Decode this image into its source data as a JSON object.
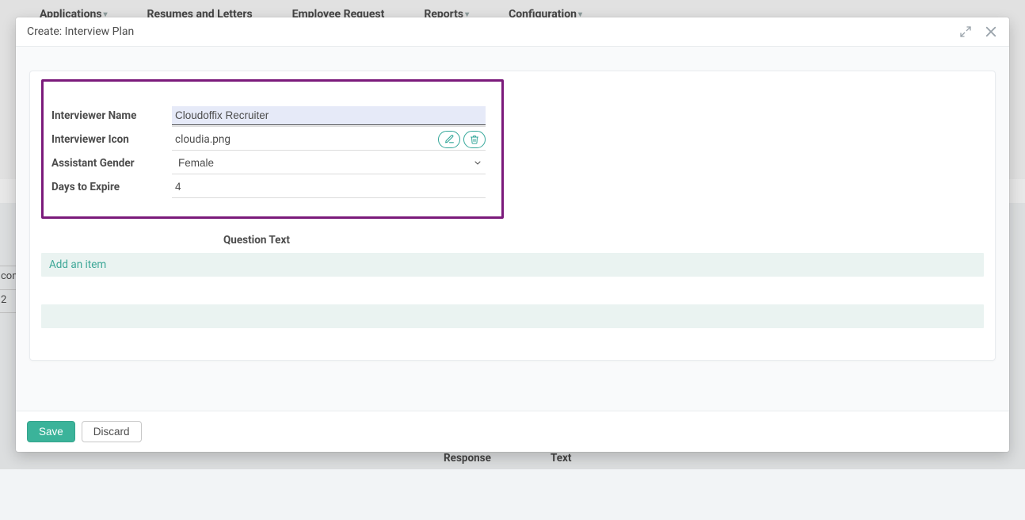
{
  "bg": {
    "menu": [
      "Applications",
      "Resumes and Letters",
      "Employee Request",
      "Reports",
      "Configuration"
    ],
    "left_col_top": "com",
    "left_col_bottom": "2",
    "bottom_labels": [
      "Response",
      "Text"
    ]
  },
  "modal": {
    "title": "Create: Interview Plan",
    "fields": {
      "interviewer_name_label": "Interviewer Name",
      "interviewer_name_value": "Cloudoffix Recruiter",
      "interviewer_icon_label": "Interviewer Icon",
      "interviewer_icon_value": "cloudia.png",
      "assistant_gender_label": "Assistant Gender",
      "assistant_gender_value": "Female",
      "days_to_expire_label": "Days to Expire",
      "days_to_expire_value": "4"
    },
    "question_header": "Question Text",
    "add_item_label": "Add an item",
    "save_label": "Save",
    "discard_label": "Discard"
  }
}
